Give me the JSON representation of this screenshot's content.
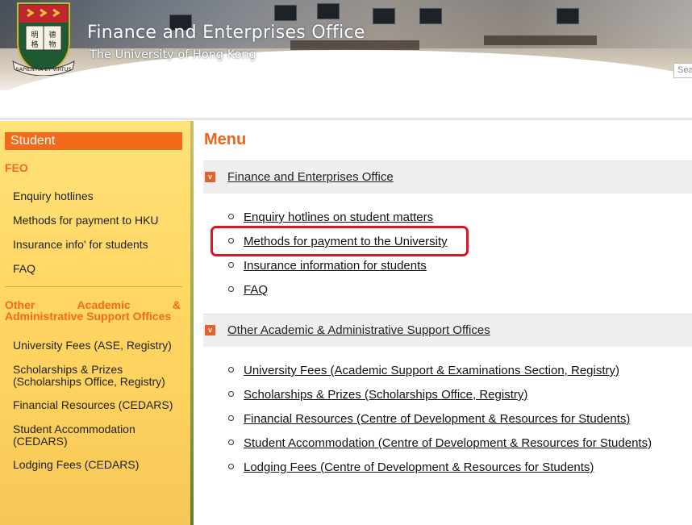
{
  "header": {
    "site_title": "Finance and Enterprises Office",
    "site_subtitle": "The University of Hong Kong",
    "logo_motto": "SAPIENTIA·ET·VIRTUS",
    "search_placeholder": "Sea"
  },
  "sidebar": {
    "heading": "Student",
    "feo_heading": "FEO",
    "feo_links": [
      "Enquiry hotlines",
      "Methods for payment to HKU",
      "Insurance info' for students",
      "FAQ"
    ],
    "other_heading_words": [
      "Other",
      "Academic",
      "&"
    ],
    "other_heading_line2": "Administrative Support Offices",
    "other_links": [
      "University Fees (ASE, Registry)",
      "Scholarships & Prizes\n(Scholarships Office, Registry)",
      "Financial Resources (CEDARS)",
      "Student Accommodation\n(CEDARS)",
      "Lodging Fees (CEDARS)"
    ]
  },
  "main": {
    "menu_title": "Menu",
    "toggle_symbol": "v",
    "groups": [
      {
        "label": "Finance and Enterprises Office",
        "links": [
          "Enquiry hotlines on student matters",
          "Methods for payment to the University",
          "Insurance information for students",
          "FAQ"
        ]
      },
      {
        "label": "Other Academic & Administrative Support Offices",
        "links": [
          "University Fees (Academic Support & Examinations Section, Registry)",
          "Scholarships & Prizes (Scholarships Office, Registry)",
          "Financial Resources (Centre of Development & Resources for Students)",
          "Student Accommodation (Centre of Development & Resources for Students)",
          "Lodging Fees (Centre of Development & Resources for Students)"
        ]
      }
    ]
  },
  "colors": {
    "accent_orange": "#f26a1b",
    "sidebar_yellow": "#ffd765",
    "highlight_red": "#e0141e"
  }
}
